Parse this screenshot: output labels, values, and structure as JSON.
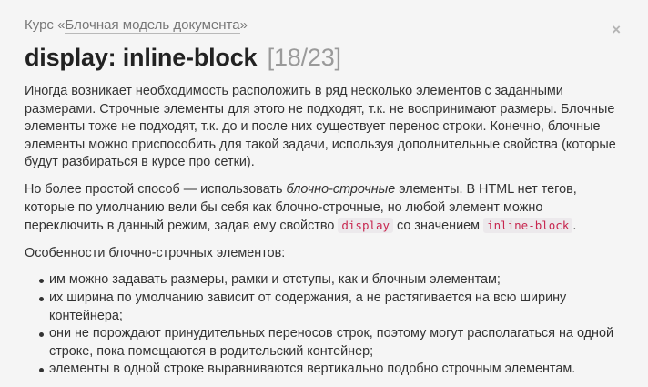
{
  "header": {
    "course_prefix": "Курс «",
    "course_link": "Блочная модель документа",
    "course_suffix": "»",
    "title": "display: inline-block",
    "counter": "[18/23]",
    "close_glyph": "×"
  },
  "content": {
    "p1": "Иногда возникает необходимость расположить в ряд несколько элементов с заданными размерами. Строчные элементы для этого не подходят, т.к. не воспринимают размеры. Блочные элементы тоже не подходят, т.к. до и после них существует перенос строки. Конечно, блочные элементы можно приспособить для такой задачи, используя дополнительные свойства (которые будут разбираться в курсе про сетки).",
    "p2_part1": "Но более простой способ — использовать ",
    "p2_em": "блочно-строчные",
    "p2_part2": " элементы. В HTML нет тегов, которые по умолчанию вели бы себя как блочно-строчные, но любой элемент можно переключить в данный режим, задав ему свойство ",
    "p2_code1": "display",
    "p2_part3": " со значением ",
    "p2_code2": "inline-block",
    "p2_part4": ".",
    "p3": "Особенности блочно-строчных элементов:",
    "features": [
      "им можно задавать размеры, рамки и отступы, как и блочным элементам;",
      "их ширина по умолчанию зависит от содержания, а не растягивается на всю ширину контейнера;",
      "они не порождают принудительных переносов строк, поэтому могут располагаться на одной строке, пока помещаются в родительский контейнер;",
      "элементы в одной строке выравниваются вертикально подобно строчным элементам."
    ]
  },
  "colors": {
    "background": "#f5f5f5",
    "code_text": "#c7254e",
    "code_bg": "#ece9ec",
    "counter": "#9a9a9a"
  }
}
